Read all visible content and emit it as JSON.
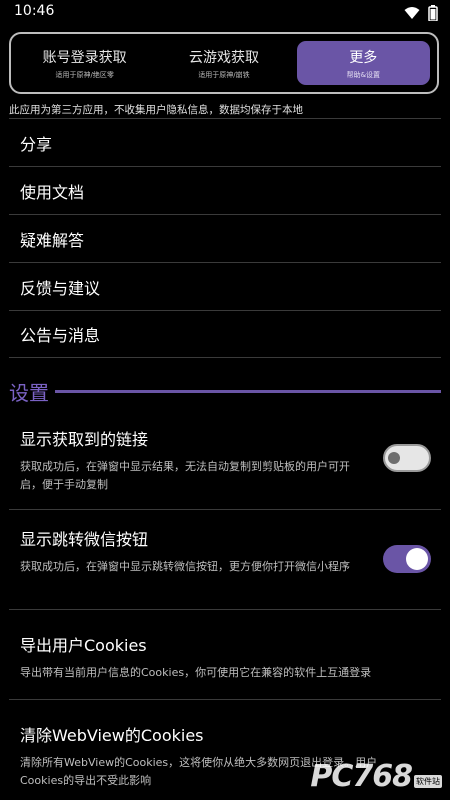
{
  "status": {
    "time": "10:46",
    "icons": [
      "wifi-icon",
      "battery-icon"
    ]
  },
  "tabs": [
    {
      "title": "账号登录获取",
      "subtitle": "适用于原神/绝区零",
      "active": false
    },
    {
      "title": "云游戏获取",
      "subtitle": "适用于原神/崩铁",
      "active": false
    },
    {
      "title": "更多",
      "subtitle": "帮助&设置",
      "active": true
    }
  ],
  "notice": "此应用为第三方应用，不收集用户隐私信息，数据均保存于本地",
  "menu": [
    {
      "label": "分享"
    },
    {
      "label": "使用文档"
    },
    {
      "label": "疑难解答"
    },
    {
      "label": "反馈与建议"
    },
    {
      "label": "公告与消息"
    }
  ],
  "settings_header": "设置",
  "settings": [
    {
      "title": "显示获取到的链接",
      "desc": "获取成功后，在弹窗中显示结果，无法自动复制到剪贴板的用户可开启，便于手动复制",
      "toggle": false
    },
    {
      "title": "显示跳转微信按钮",
      "desc": "获取成功后，在弹窗中显示跳转微信按钮，更方便你打开微信小程序",
      "toggle": true
    },
    {
      "title": "导出用户Cookies",
      "desc": "导出带有当前用户信息的Cookies，你可使用它在兼容的软件上互通登录"
    },
    {
      "title": "清除WebView的Cookies",
      "desc": "清除所有WebView的Cookies，这将使你从绝大多数网页退出登录。用户Cookies的导出不受此影响"
    }
  ],
  "watermark": {
    "logo": "PC768",
    "badge": "软件站"
  },
  "colors": {
    "accent": "#6a55a6",
    "background": "#000000"
  }
}
